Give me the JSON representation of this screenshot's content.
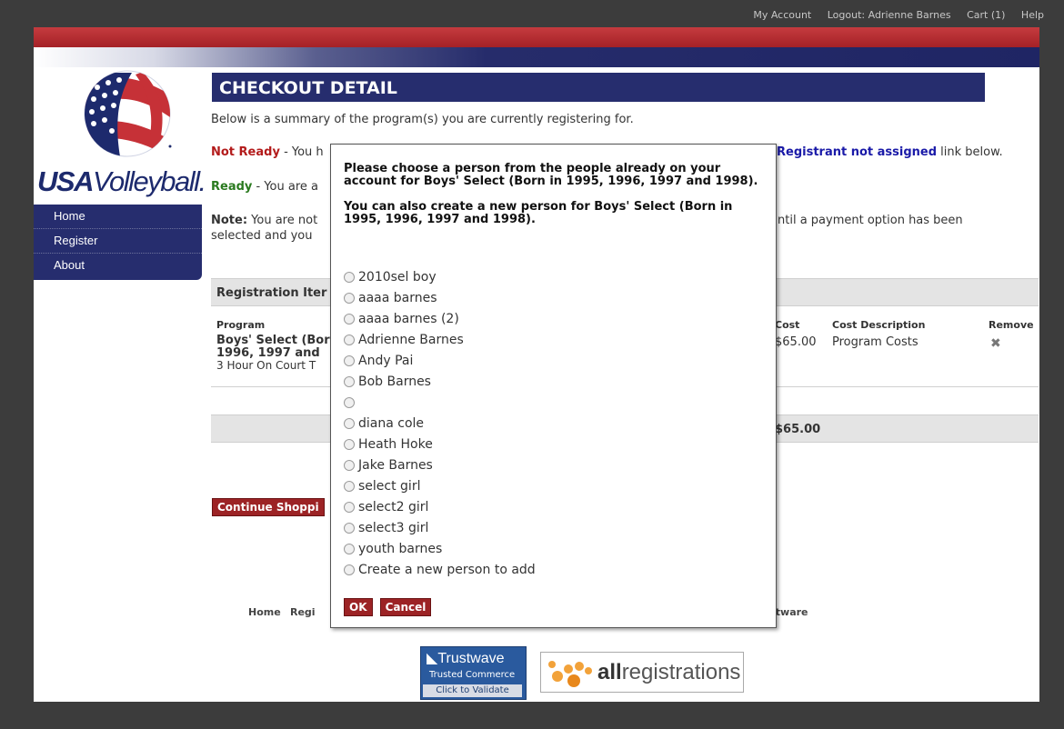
{
  "top_links": [
    "My Account",
    "Logout: Adrienne Barnes",
    "Cart (1)",
    "Help"
  ],
  "logo": {
    "usa": "USA",
    "volleyball": "Volleyball."
  },
  "nav": [
    "Home",
    "Register",
    "About"
  ],
  "main": {
    "title": "CHECKOUT DETAIL",
    "summary": "Below is a summary of the program(s) you are currently registering for.",
    "not_ready_label": "Not Ready",
    "not_ready_text": " - You h",
    "registrant_link": "Registrant not assigned",
    "link_below": " link below.",
    "ready_label": "Ready",
    "ready_text": " - You are a",
    "note_label": "Note:",
    "note_text1": " You are not",
    "note_text1b": "ntil a payment option has been",
    "note_text2": "selected and you",
    "section_title": "Registration Iter",
    "col_program": "Program",
    "col_cost": "Cost",
    "col_cost_desc": "Cost Description",
    "col_remove": "Remove",
    "row_program_1": "Boys' Select (Bor",
    "row_program_2": "1996, 1997 and",
    "row_program_3": "3 Hour On Court T",
    "row_cost": "$65.00",
    "row_cost_desc": "Program Costs",
    "total": "$65.00",
    "continue_button": "Continue Shoppi"
  },
  "footer": {
    "home": "Home",
    "regi": "Regi",
    "software": "ftware"
  },
  "badges": {
    "trustwave_title": "Trustwave",
    "trustwave_sub": "Trusted Commerce",
    "trustwave_validate": "Click to Validate",
    "allreg_all": "all",
    "allreg_rest": "registrations"
  },
  "modal": {
    "line1": "Please choose a person from the people already on your account for Boys' Select (Born in 1995, 1996, 1997 and 1998).",
    "line2": "You can also create a new person for Boys' Select (Born in 1995, 1996, 1997 and 1998).",
    "options": [
      "2010sel boy",
      "aaaa barnes",
      "aaaa barnes (2)",
      "Adrienne Barnes",
      "Andy Pai",
      "Bob Barnes",
      "",
      "diana cole",
      "Heath Hoke",
      "Jake Barnes",
      "select girl",
      "select2 girl",
      "select3 girl",
      "youth barnes",
      "Create a new person to add"
    ],
    "ok": "OK",
    "cancel": "Cancel"
  },
  "colors": {
    "navy": "#262d6e",
    "red": "#b31b1b",
    "button": "#9c2325"
  }
}
